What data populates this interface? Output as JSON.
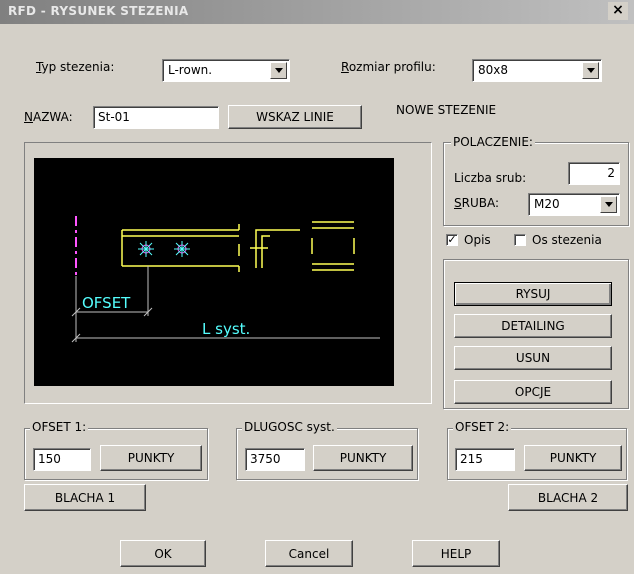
{
  "window": {
    "title": "RFD - RYSUNEK STEZENIA",
    "close_glyph": "×"
  },
  "typ": {
    "label": "Typ stezenia:",
    "value": "L-rown."
  },
  "rozmiar": {
    "label": "Rozmiar profilu:",
    "value": "80x8"
  },
  "nazwa": {
    "label": "NAZWA:",
    "value": "St-01"
  },
  "wskaz_button": "WSKAZ LINIE",
  "nowe_label": "NOWE STEZENIE",
  "polaczenie": {
    "title": "POLACZENIE:",
    "liczba_label": "Liczba srub:",
    "liczba_value": "2",
    "sruba_label": "SRUBA:",
    "sruba_value": "M20"
  },
  "opis": {
    "label": "Opis",
    "checked": true,
    "mark": "✓"
  },
  "os": {
    "label": "Os stezenia",
    "checked": false
  },
  "actions": {
    "rysuj": "RYSUJ",
    "detailing": "DETAILING",
    "usun": "USUN",
    "opcje": "OPCJE"
  },
  "drawing": {
    "ofset_text": "OFSET",
    "lsyst_text": "L syst.",
    "colors": {
      "yellow": "#ffff55",
      "cyan": "#55ffff",
      "magenta": "#ff55ff",
      "gray": "#c0c0c0"
    }
  },
  "ofset1": {
    "title": "OFSET 1:",
    "value": "150",
    "button": "PUNKTY"
  },
  "dlugosc": {
    "title": "DLUGOSC syst.",
    "value": "3750",
    "button": "PUNKTY"
  },
  "ofset2": {
    "title": "OFSET 2:",
    "value": "215",
    "button": "PUNKTY"
  },
  "blacha1": "BLACHA 1",
  "blacha2": "BLACHA 2",
  "footer": {
    "ok": "OK",
    "cancel": "Cancel",
    "help": "HELP"
  }
}
